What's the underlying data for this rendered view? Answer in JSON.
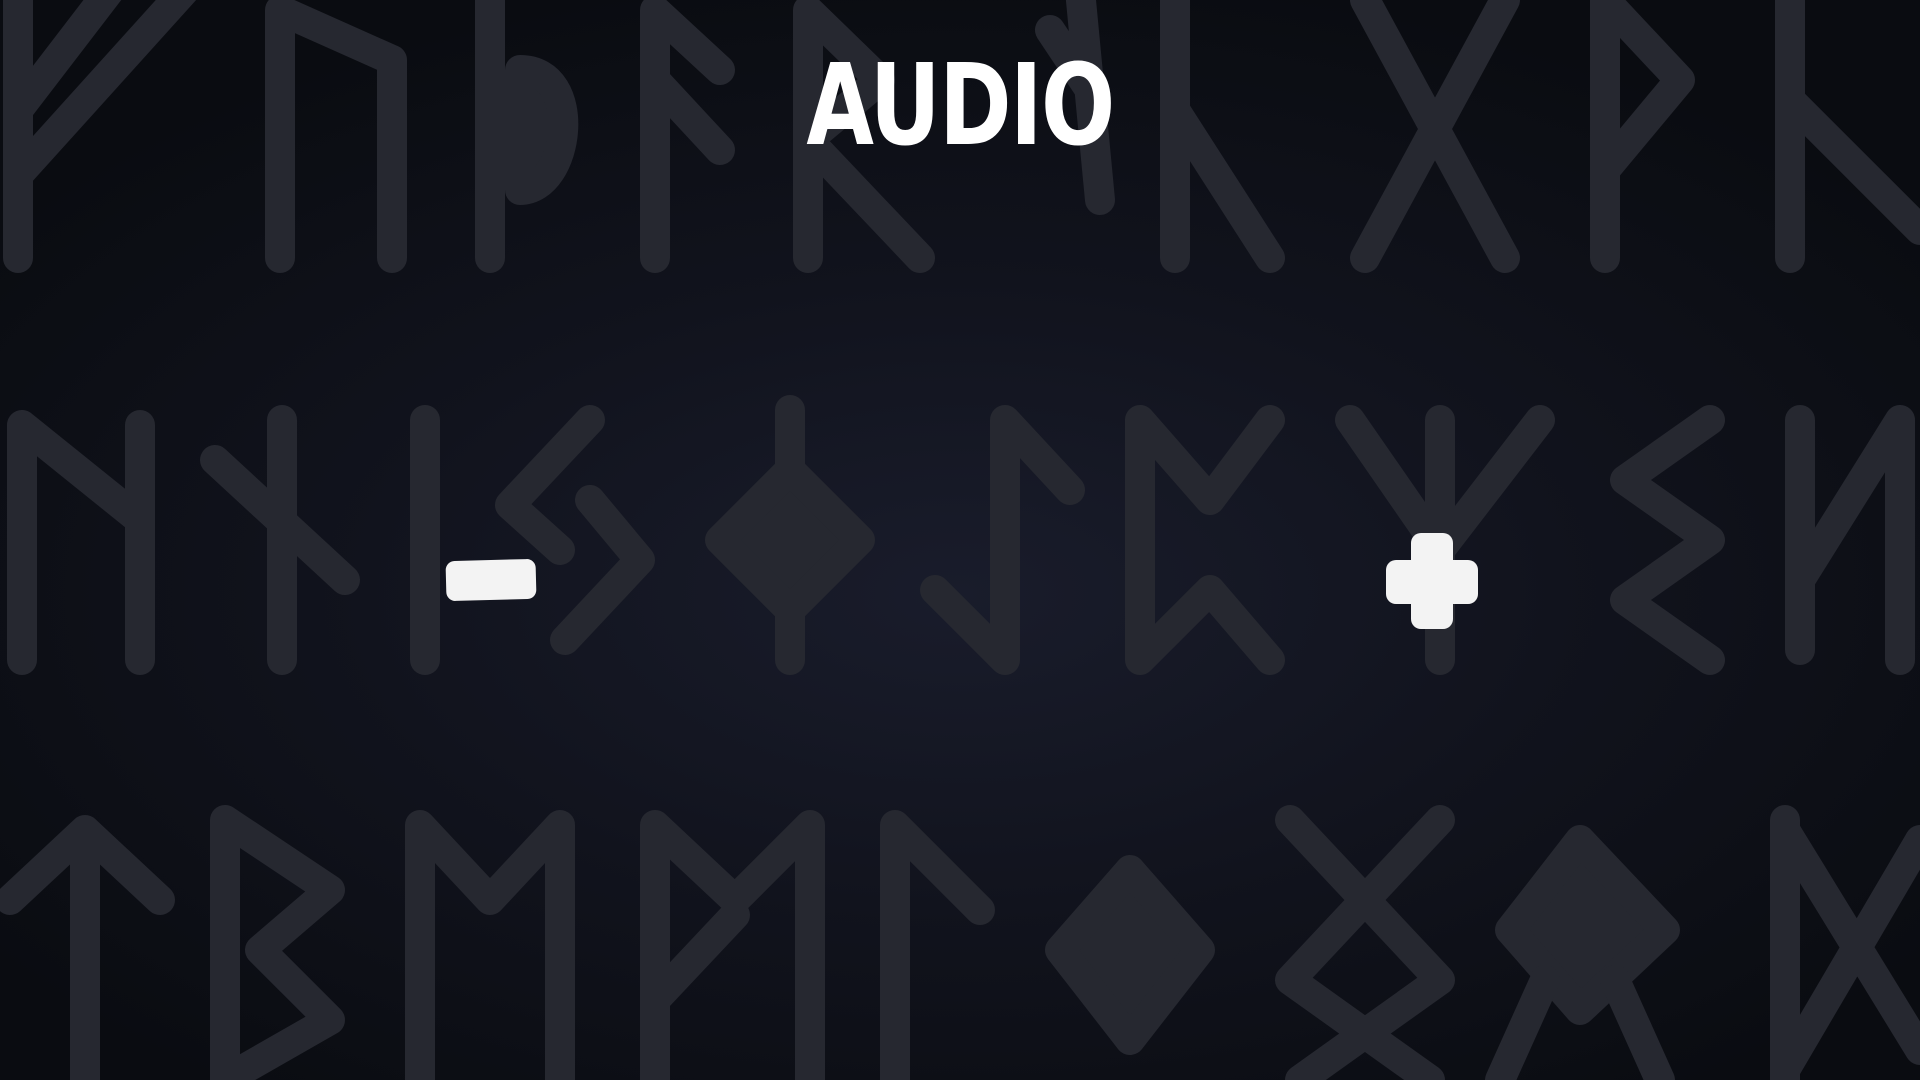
{
  "screen": {
    "title": "AUDIO",
    "background_color": "#0b0d13",
    "rune_color": "#262830",
    "button_color": "#f3f3f3"
  },
  "controls": {
    "volume_down": {
      "icon": "minus-icon"
    },
    "volume_up": {
      "icon": "plus-icon"
    }
  }
}
